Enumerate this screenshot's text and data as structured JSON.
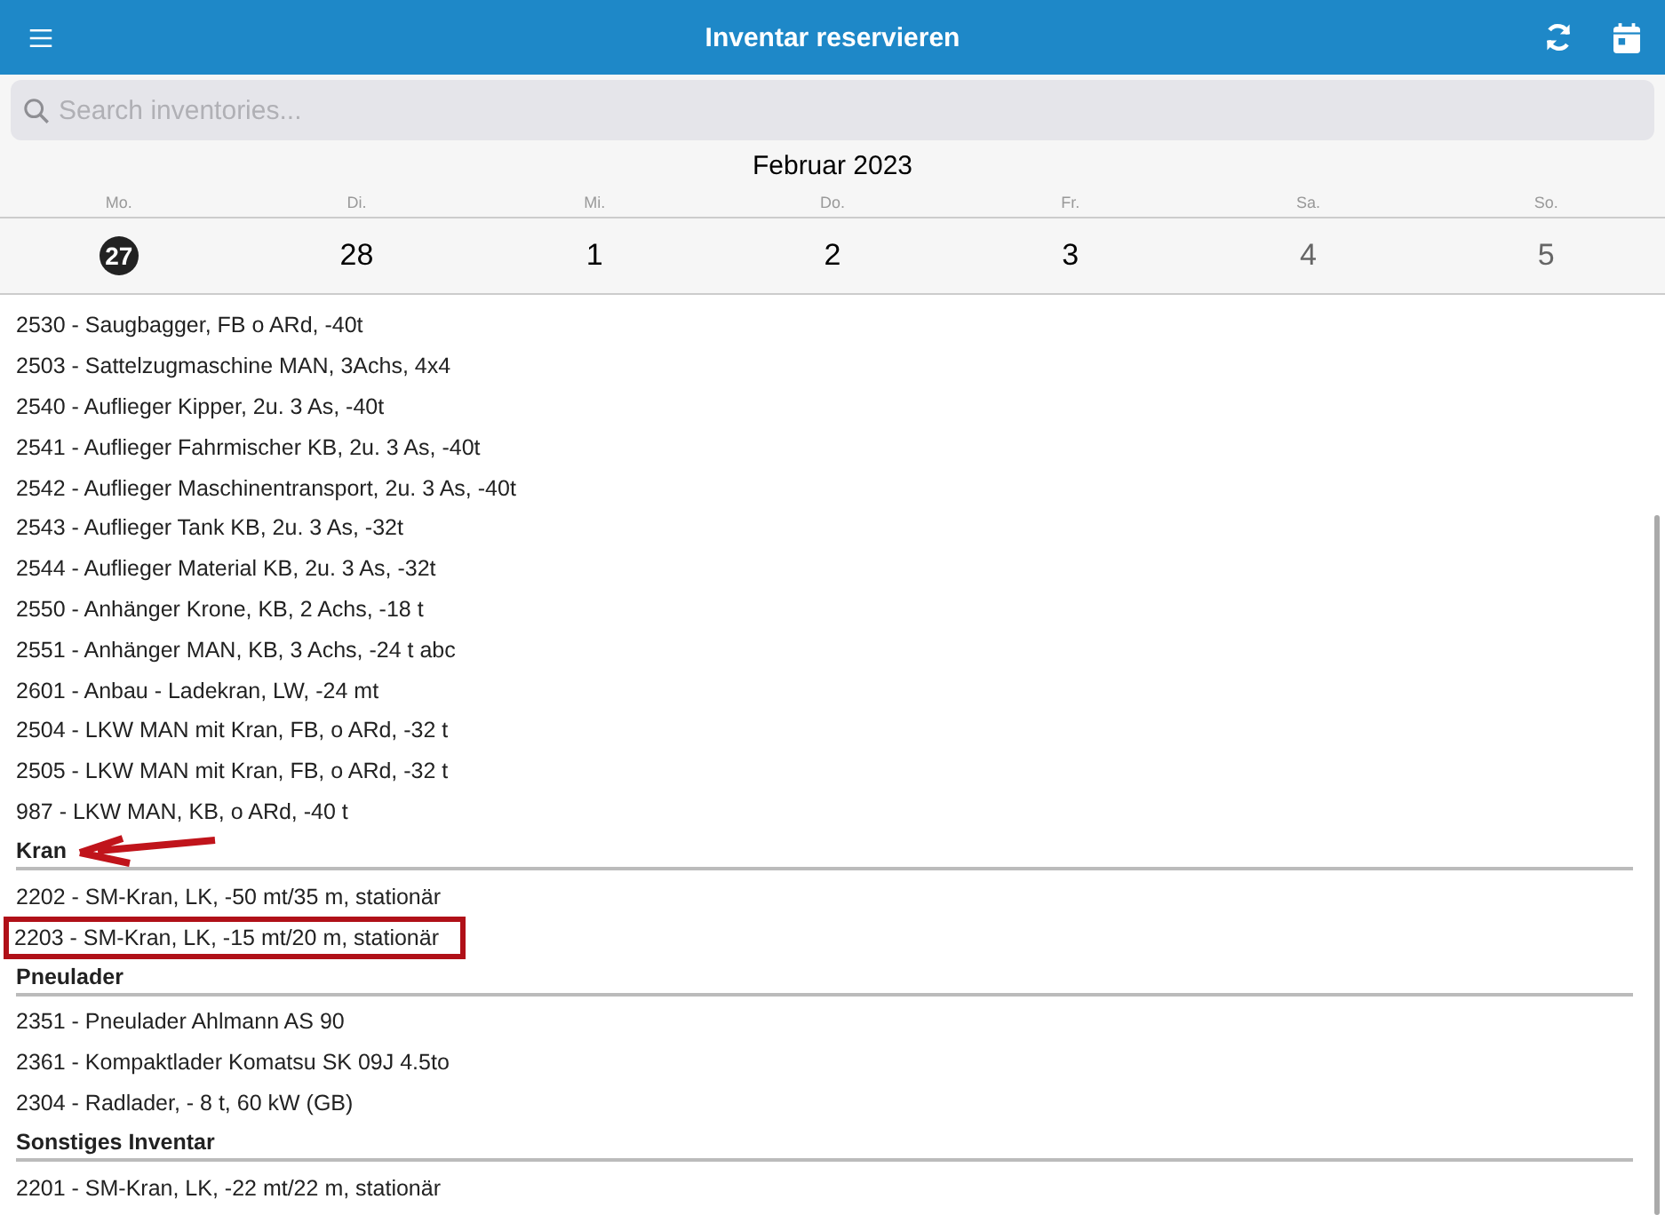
{
  "header": {
    "title": "Inventar reservieren"
  },
  "search": {
    "placeholder": "Search inventories..."
  },
  "calendar": {
    "month": "Februar 2023",
    "days": [
      {
        "weekday": "Mo.",
        "date": "27",
        "selected": true,
        "weekend": false
      },
      {
        "weekday": "Di.",
        "date": "28",
        "selected": false,
        "weekend": false
      },
      {
        "weekday": "Mi.",
        "date": "1",
        "selected": false,
        "weekend": false
      },
      {
        "weekday": "Do.",
        "date": "2",
        "selected": false,
        "weekend": false
      },
      {
        "weekday": "Fr.",
        "date": "3",
        "selected": false,
        "weekend": false
      },
      {
        "weekday": "Sa.",
        "date": "4",
        "selected": false,
        "weekend": true
      },
      {
        "weekday": "So.",
        "date": "5",
        "selected": false,
        "weekend": true
      }
    ]
  },
  "groups": [
    {
      "items": [
        {
          "label": "2530 - Saugbagger, FB o ARd, -40t",
          "highlighted": false
        },
        {
          "label": "2503 - Sattelzugmaschine MAN, 3Achs, 4x4",
          "highlighted": false
        },
        {
          "label": "2540 - Auflieger Kipper, 2u. 3 As, -40t",
          "highlighted": false
        },
        {
          "label": "2541 - Auflieger Fahrmischer KB, 2u. 3 As, -40t",
          "highlighted": false
        },
        {
          "label": "2542 - Auflieger Maschinentransport, 2u. 3 As, -40t",
          "highlighted": false
        },
        {
          "label": "2543 - Auflieger Tank KB, 2u. 3 As, -32t",
          "highlighted": false
        },
        {
          "label": "2544 - Auflieger Material  KB, 2u. 3 As, -32t",
          "highlighted": false
        },
        {
          "label": "2550 -  Anhänger Krone, KB, 2 Achs, -18 t",
          "highlighted": false
        },
        {
          "label": "2551 - Anhänger MAN, KB, 3 Achs, -24 t abc",
          "highlighted": false
        },
        {
          "label": "2601 - Anbau - Ladekran, LW, -24 mt",
          "highlighted": false
        },
        {
          "label": "2504 - LKW MAN mit Kran, FB, o ARd, -32 t",
          "highlighted": false
        },
        {
          "label": "2505 - LKW MAN mit Kran, FB, o ARd, -32 t",
          "highlighted": false
        },
        {
          "label": "987 - LKW MAN, KB, o ARd, -40 t",
          "highlighted": false
        }
      ]
    },
    {
      "title": "Kran",
      "pointed": true,
      "items": [
        {
          "label": "2202 - SM-Kran, LK, -50 mt/35 m, stationär",
          "highlighted": false
        },
        {
          "label": "2203 - SM-Kran, LK, -15 mt/20 m, stationär",
          "highlighted": true
        }
      ]
    },
    {
      "title": "Pneulader",
      "pointed": false,
      "items": [
        {
          "label": "2351 - Pneulader Ahlmann AS 90",
          "highlighted": false
        },
        {
          "label": "2361 - Kompaktlader Komatsu SK 09J 4.5to",
          "highlighted": false
        },
        {
          "label": "2304 - Radlader, - 8 t,  60 kW (GB)",
          "highlighted": false
        }
      ]
    },
    {
      "title": "Sonstiges Inventar",
      "pointed": false,
      "items": [
        {
          "label": "2201 - SM-Kran, LK, -22 mt/22 m, stationär",
          "highlighted": false
        }
      ]
    }
  ]
}
